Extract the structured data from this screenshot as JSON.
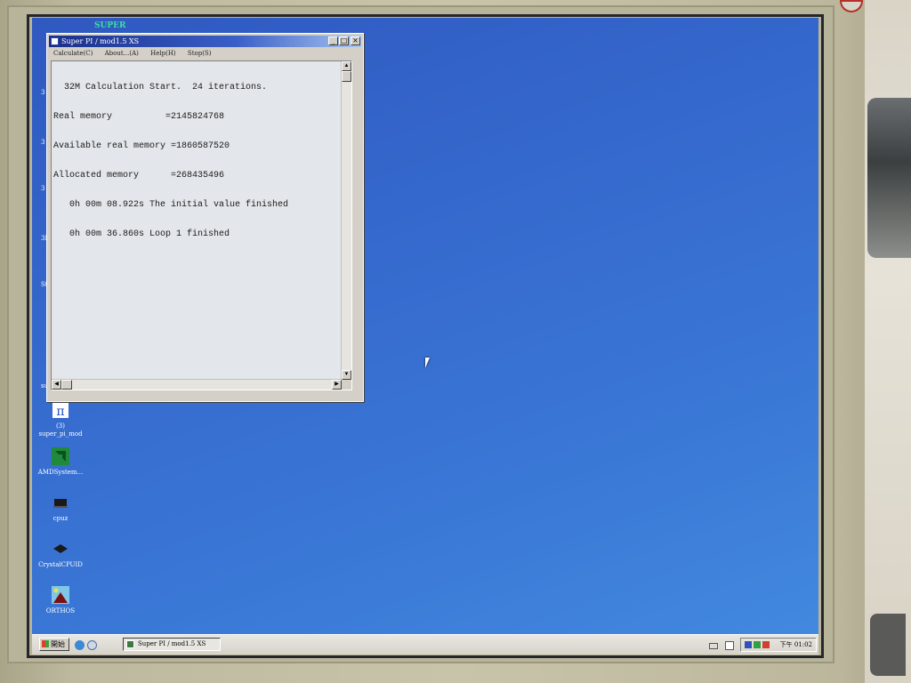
{
  "window": {
    "title": "Super PI / mod1.5 XS",
    "menu": [
      "Calculate(C)",
      "About...(A)",
      "Help(H)",
      "Stop(S)"
    ],
    "log_lines": [
      "  32M Calculation Start.  24 iterations.",
      "Real memory          =2145824768",
      "Available real memory =1860587520",
      "Allocated memory      =268435496",
      "   0h 00m 08.922s The initial value finished",
      "   0h 00m 36.860s Loop 1 finished"
    ]
  },
  "desktop": {
    "top_label": "SUPER",
    "left_clipped": [
      "3",
      "3",
      "3",
      "3D",
      "Sta",
      "sup"
    ],
    "icons": [
      {
        "label": "(3)\nsuper_pi_mod",
        "icon": "super-pi-icon"
      },
      {
        "label": "AMDSystem...",
        "icon": "amd-icon"
      },
      {
        "label": "cpuz",
        "icon": "chip-icon"
      },
      {
        "label": "CrystalCPUID",
        "icon": "chip-icon"
      },
      {
        "label": "ORTHOS",
        "icon": "orthos-icon"
      }
    ]
  },
  "taskbar": {
    "start_label": "開始",
    "task_label": "Super PI / mod1.5 XS",
    "clock": "下午 01:02"
  },
  "colors": {
    "desktop": "#3568cc",
    "titlebar": "#1a2f8a"
  }
}
